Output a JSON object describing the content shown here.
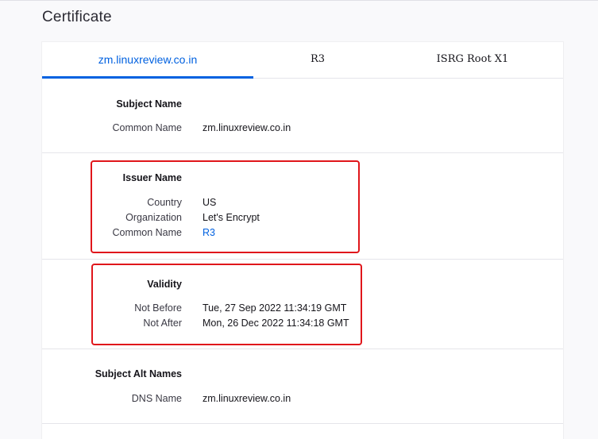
{
  "page": {
    "title": "Certificate"
  },
  "tabs": [
    {
      "label": "zm.linuxreview.co.in",
      "active": true
    },
    {
      "label": "R3",
      "active": false
    },
    {
      "label": "ISRG Root X1",
      "active": false
    }
  ],
  "subject": {
    "heading": "Subject Name",
    "rows": [
      {
        "label": "Common Name",
        "value": "zm.linuxreview.co.in"
      }
    ]
  },
  "issuer": {
    "heading": "Issuer Name",
    "rows": [
      {
        "label": "Country",
        "value": "US"
      },
      {
        "label": "Organization",
        "value": "Let's Encrypt"
      },
      {
        "label": "Common Name",
        "value": "R3"
      }
    ]
  },
  "validity": {
    "heading": "Validity",
    "rows": [
      {
        "label": "Not Before",
        "value": "Tue, 27 Sep 2022 11:34:19 GMT"
      },
      {
        "label": "Not After",
        "value": "Mon, 26 Dec 2022 11:34:18 GMT"
      }
    ]
  },
  "alt_names": {
    "heading": "Subject Alt Names",
    "rows": [
      {
        "label": "DNS Name",
        "value": "zm.linuxreview.co.in"
      }
    ]
  },
  "colors": {
    "accent": "#0061e0",
    "highlight": "#e0161b"
  }
}
